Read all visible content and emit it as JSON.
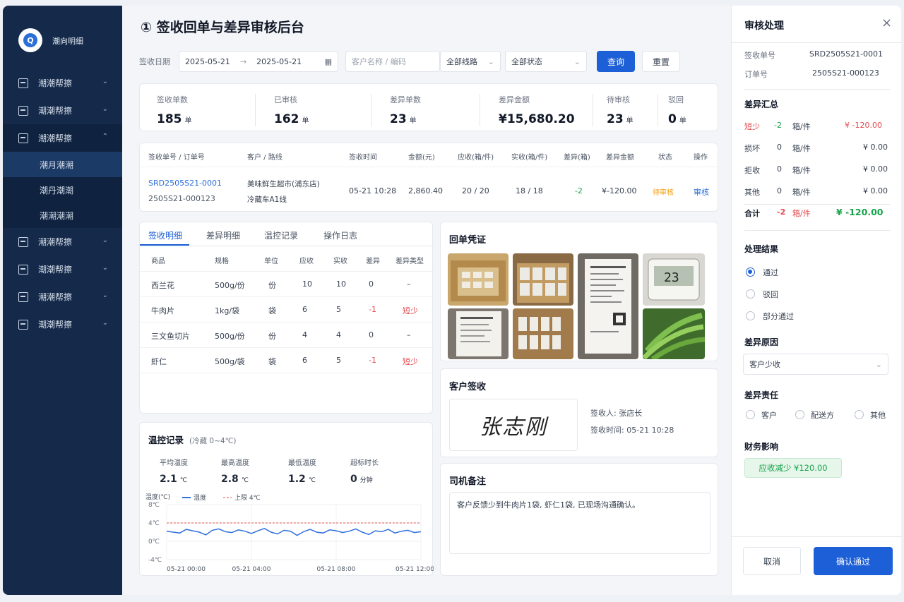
{
  "sidebar": {
    "brand": "潮向明细",
    "items": [
      {
        "label": "潮潮帮擦",
        "open": false
      },
      {
        "label": "潮潮帮擦",
        "open": false
      },
      {
        "label": "潮潮帮擦",
        "open": true
      }
    ],
    "sub_items": [
      {
        "label": "潮月潮潮",
        "active": true
      },
      {
        "label": "潮丹潮潮",
        "active": false
      },
      {
        "label": "潮潮潮潮",
        "active": false
      }
    ],
    "items_after": [
      {
        "label": "潮潮帮擦"
      },
      {
        "label": "潮潮帮擦"
      },
      {
        "label": "潮潮帮擦"
      },
      {
        "label": "潮潮帮擦"
      }
    ]
  },
  "header": {
    "title": "① 签收回单与差异审核后台"
  },
  "filter": {
    "date_label": "签收日期",
    "date_from": "2025-05-21",
    "arrow": "→",
    "date_to": "2025-05-21",
    "customer_placeholder": "客户名称 / 编码",
    "route": "全部线路",
    "status": "全部状态",
    "query_label": "查询",
    "reset_label": "重置"
  },
  "stats": [
    {
      "label": "签收单数",
      "value": "185",
      "unit": "单"
    },
    {
      "label": "已审核",
      "value": "162",
      "unit": "单"
    },
    {
      "label": "差异单数",
      "value": "23",
      "unit": "单"
    },
    {
      "label": "差异金额",
      "value": "¥15,680.20",
      "unit": ""
    },
    {
      "label": "待审核",
      "value": "23",
      "unit": "单"
    },
    {
      "label": "驳回",
      "value": "0",
      "unit": "单"
    }
  ],
  "order_table": {
    "headers": [
      "签收单号 / 订单号",
      "客户 / 路线",
      "签收时间",
      "金额(元)",
      "应收(箱/件)",
      "实收(箱/件)",
      "差异(箱)",
      "差异金额",
      "状态",
      "操作"
    ],
    "row": {
      "receipt_no": "SRD2505S21-0001",
      "order_no": "2505S21-000123",
      "customer": "美味鲜生超市(浦东店)",
      "route": "冷藏车A1线",
      "time": "05-21 10:28",
      "amount": "2,860.40",
      "due": "20 / 20",
      "received": "18 / 18",
      "diff": "-2",
      "diff_amount": "¥-120.00",
      "status": "待审核",
      "action": "审核"
    }
  },
  "detail_tabs": [
    "签收明细",
    "差异明细",
    "温控记录",
    "操作日志"
  ],
  "detail_table": {
    "headers": [
      "商品",
      "规格",
      "单位",
      "应收",
      "实收",
      "差异",
      "差异类型"
    ],
    "rows": [
      {
        "name": "西兰花",
        "spec": "500g/份",
        "unit": "份",
        "due": "10",
        "got": "10",
        "diff": "0",
        "type": "–",
        "neg": false
      },
      {
        "name": "牛肉片",
        "spec": "1kg/袋",
        "unit": "袋",
        "due": "6",
        "got": "5",
        "diff": "-1",
        "type": "短少",
        "neg": true
      },
      {
        "name": "三文鱼切片",
        "spec": "500g/份",
        "unit": "份",
        "due": "4",
        "got": "4",
        "diff": "0",
        "type": "–",
        "neg": false
      },
      {
        "name": "虾仁",
        "spec": "500g/袋",
        "unit": "袋",
        "due": "6",
        "got": "5",
        "diff": "-1",
        "type": "短少",
        "neg": true
      }
    ]
  },
  "temp": {
    "title": "温控记录",
    "subtitle": "(冷藏 0~4℃)",
    "stats": [
      {
        "label": "平均温度",
        "value": "2.1",
        "unit": "℃"
      },
      {
        "label": "最高温度",
        "value": "2.8",
        "unit": "℃"
      },
      {
        "label": "最低温度",
        "value": "1.2",
        "unit": "℃"
      },
      {
        "label": "超标时长",
        "value": "0",
        "unit": "分钟"
      }
    ]
  },
  "chart_data": {
    "type": "line",
    "ylabel": "温度(℃)",
    "ylim": [
      -4,
      8
    ],
    "yticks": [
      "8℃",
      "4℃",
      "0℃",
      "-4℃"
    ],
    "xticks": [
      "05-21 00:00",
      "05-21 04:00",
      "05-21 08:00",
      "05-21 12:00"
    ],
    "upper_limit": 4,
    "legend": "top-left",
    "series": [
      {
        "name": "温度",
        "color": "#2f6fde",
        "values": [
          2.2,
          2.0,
          1.8,
          2.6,
          2.3,
          2.0,
          1.4,
          2.4,
          2.7,
          2.1,
          1.9,
          2.5,
          2.2,
          1.7,
          2.3,
          2.8,
          2.0,
          1.6,
          2.4,
          2.2,
          1.3,
          2.1,
          2.6,
          2.0,
          1.8,
          2.5,
          2.3,
          1.9,
          2.2,
          2.7,
          2.0,
          1.5,
          2.3,
          2.1,
          2.6,
          1.8,
          2.2,
          2.4,
          1.9,
          2.1
        ]
      },
      {
        "name": "上限 4℃",
        "color": "#e0574f",
        "values": [
          4,
          4
        ]
      }
    ]
  },
  "voucher": {
    "title": "回单凭证",
    "screen_text": "23"
  },
  "signature": {
    "title": "客户签收",
    "sign": "张志刚",
    "signer_label": "签收人: 张店长",
    "time_label": "签收时间: 05-21 10:28"
  },
  "driver_note": {
    "title": "司机备注",
    "text": "客户反馈少到牛肉片1袋, 虾仁1袋, 已现场沟通确认。"
  },
  "panel": {
    "title": "审核处理",
    "receipt_label": "签收单号",
    "receipt_value": "SRD2505S21-0001",
    "order_label": "订单号",
    "order_value": "2505S21-000123",
    "summary_title": "差异汇总",
    "summary": [
      {
        "name": "短少",
        "qty": "-2",
        "unit": "箱/件",
        "amount": "¥ -120.00",
        "hl": true
      },
      {
        "name": "损坏",
        "qty": "0",
        "unit": "箱/件",
        "amount": "¥ 0.00",
        "hl": false
      },
      {
        "name": "拒收",
        "qty": "0",
        "unit": "箱/件",
        "amount": "¥ 0.00",
        "hl": false
      },
      {
        "name": "其他",
        "qty": "0",
        "unit": "箱/件",
        "amount": "¥ 0.00",
        "hl": false
      }
    ],
    "total": {
      "name": "合计",
      "qty": "-2",
      "unit": "箱/件",
      "amount": "¥ -120.00"
    },
    "result_title": "处理结果",
    "results": [
      "通过",
      "驳回",
      "部分通过"
    ],
    "reason_title": "差异原因",
    "reason_value": "客户少收",
    "duty_title": "差异责任",
    "duties": [
      "客户",
      "配送方",
      "其他"
    ],
    "finance_title": "财务影响",
    "finance_value": "应收减少 ¥120.00",
    "cancel_label": "取消",
    "confirm_label": "确认通过"
  },
  "colors": {
    "primary": "#1d5fd6",
    "danger": "#e5484d",
    "success": "#16a34a",
    "warning": "#f59e0b",
    "sidebar": "#152a4a"
  }
}
